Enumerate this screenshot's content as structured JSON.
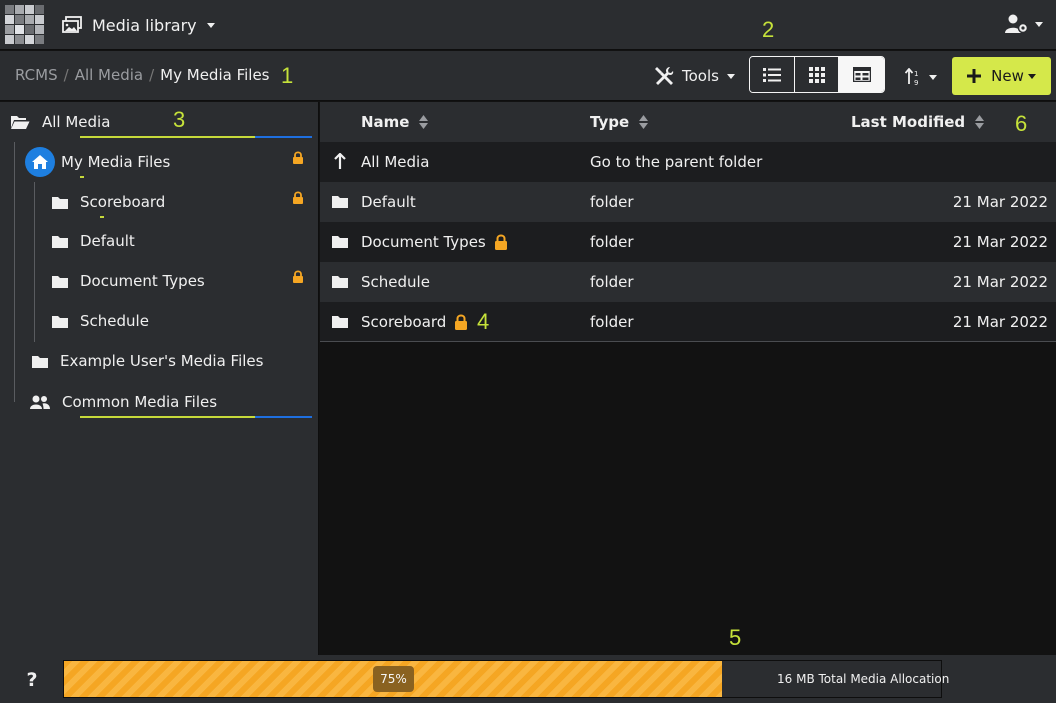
{
  "topbar": {
    "app_title": "Media library",
    "icons": [
      "apps-grid-icon",
      "media-library-icon",
      "caret-down-icon",
      "user-settings-icon"
    ]
  },
  "breadcrumb": [
    "RCMS",
    "All Media",
    "My Media Files"
  ],
  "toolbar": {
    "tools_label": "Tools",
    "view_modes": [
      "list",
      "grid",
      "table"
    ],
    "active_view": "table",
    "new_label": "New"
  },
  "sidebar": {
    "root": "All Media",
    "items": [
      {
        "label": "My Media Files",
        "icon": "home-icon",
        "locked": true
      },
      {
        "label": "Scoreboard",
        "icon": "folder-icon",
        "locked": true
      },
      {
        "label": "Default",
        "icon": "folder-icon",
        "locked": false
      },
      {
        "label": "Document Types",
        "icon": "folder-icon",
        "locked": true
      },
      {
        "label": "Schedule",
        "icon": "folder-icon",
        "locked": false
      },
      {
        "label": "Example User's Media Files",
        "icon": "folder-icon",
        "locked": false
      },
      {
        "label": "Common Media Files",
        "icon": "users-icon",
        "locked": false
      }
    ]
  },
  "table": {
    "headers": {
      "name": "Name",
      "type": "Type",
      "modified": "Last Modified"
    },
    "rows": [
      {
        "name": "All Media",
        "type": "Go to the parent folder",
        "modified": "",
        "icon": "up-arrow-icon",
        "locked": false
      },
      {
        "name": "Default",
        "type": "folder",
        "modified": "21 Mar 2022",
        "icon": "folder-icon",
        "locked": false
      },
      {
        "name": "Document Types",
        "type": "folder",
        "modified": "21 Mar 2022",
        "icon": "folder-icon",
        "locked": true
      },
      {
        "name": "Schedule",
        "type": "folder",
        "modified": "21 Mar 2022",
        "icon": "folder-icon",
        "locked": false
      },
      {
        "name": "Scoreboard",
        "type": "folder",
        "modified": "21 Mar 2022",
        "icon": "folder-icon",
        "locked": true
      }
    ]
  },
  "footer": {
    "help_label": "?",
    "allocation_percent_label": "75%",
    "allocation_fraction": 0.75,
    "allocation_label": "16 MB Total Media Allocation"
  },
  "annotations": [
    "1",
    "2",
    "3",
    "4",
    "5",
    "6"
  ],
  "colors": {
    "accent": "#d5e84a",
    "lock": "#f5a623",
    "home_badge": "#1e7fe0",
    "progress": "#f5a623",
    "annotation": "#c6e23a"
  }
}
